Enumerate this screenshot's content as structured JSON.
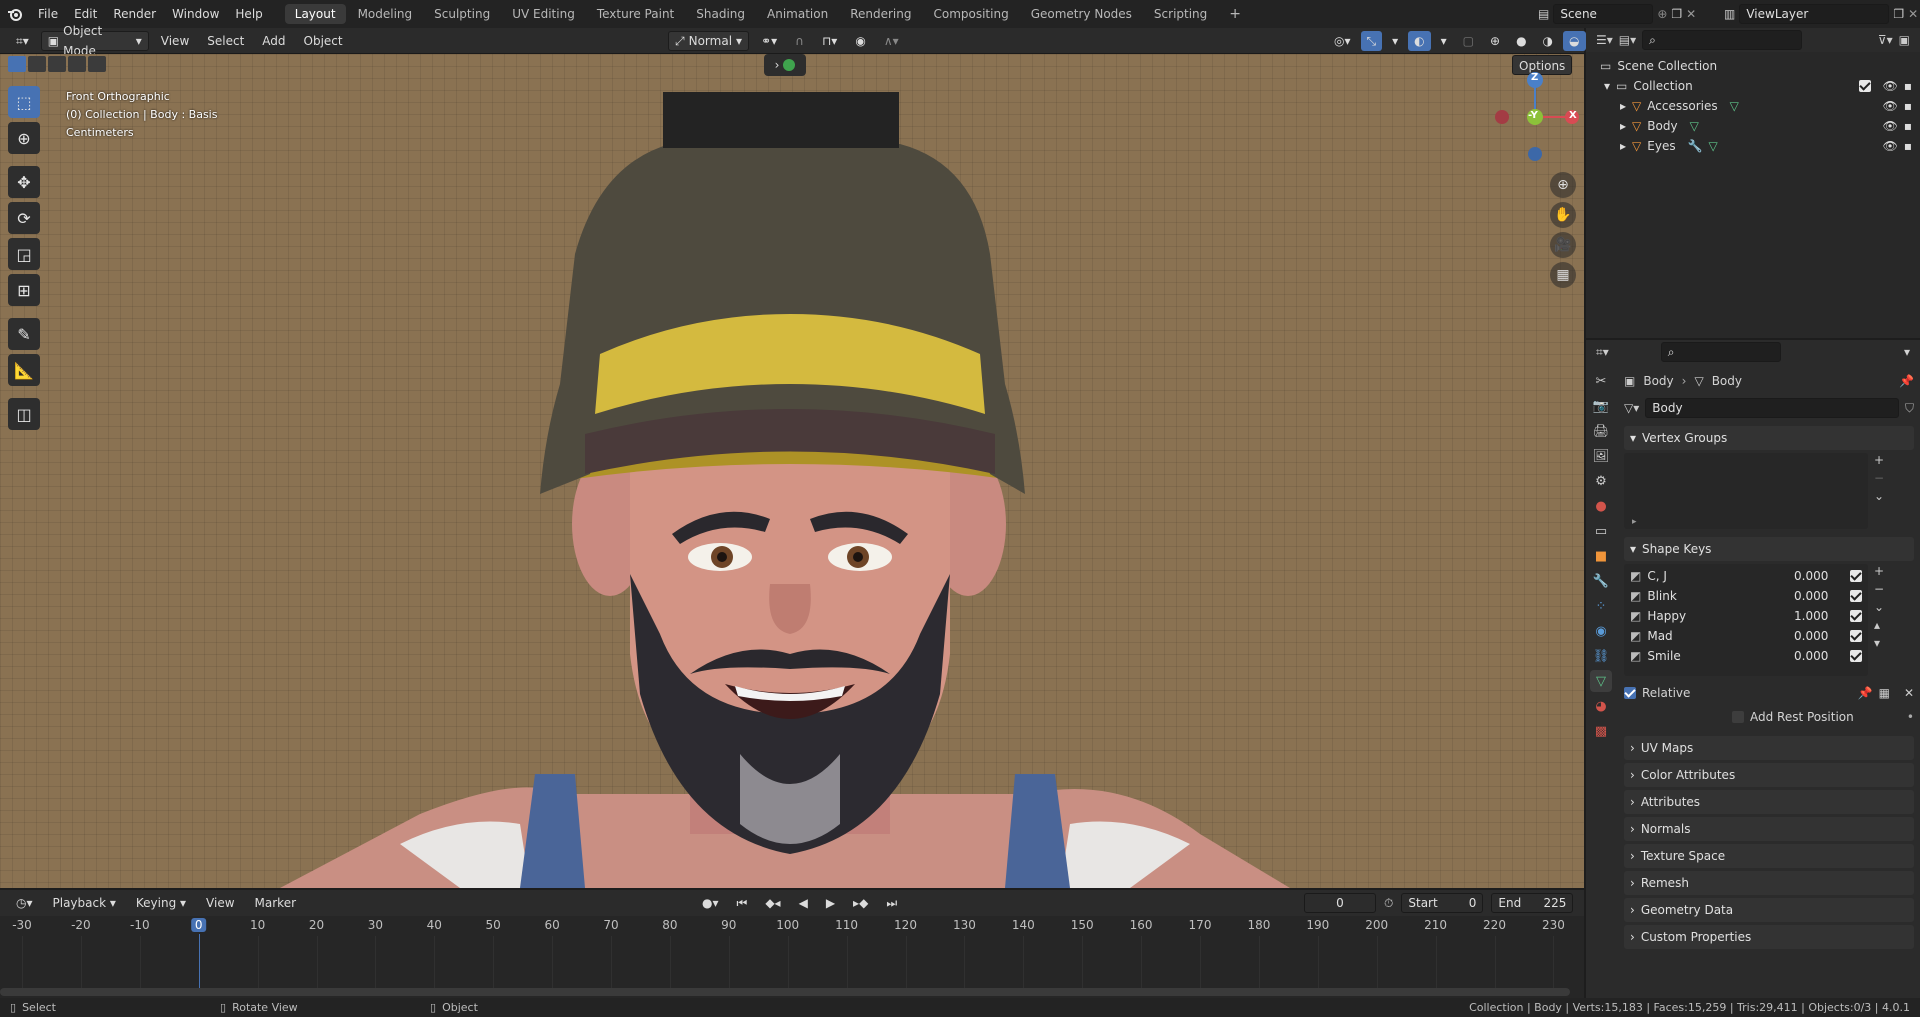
{
  "app": {
    "logo": "blender-logo"
  },
  "menu": [
    "File",
    "Edit",
    "Render",
    "Window",
    "Help"
  ],
  "workspaces": [
    "Layout",
    "Modeling",
    "Sculpting",
    "UV Editing",
    "Texture Paint",
    "Shading",
    "Animation",
    "Rendering",
    "Compositing",
    "Geometry Nodes",
    "Scripting"
  ],
  "active_workspace": "Layout",
  "scene": {
    "name": "Scene",
    "view_layer": "ViewLayer"
  },
  "viewport_header": {
    "mode": "Object Mode",
    "menus": [
      "View",
      "Select",
      "Add",
      "Object"
    ],
    "orientation": "Normal",
    "options": "Options"
  },
  "viewport": {
    "view_name": "Front Orthographic",
    "context": "(0) Collection | Body : Basis",
    "units": "Centimeters",
    "gizmo": {
      "z": "Z",
      "y": "-Y",
      "x": "X"
    },
    "colors": {
      "background": "#8a7252",
      "active_tool": "#4772b3"
    }
  },
  "outliner": {
    "root": "Scene Collection",
    "collection": "Collection",
    "items": [
      "Accessories",
      "Body",
      "Eyes"
    ]
  },
  "properties": {
    "breadcrumb": {
      "object": "Body",
      "data": "Body"
    },
    "mesh_name": "Body",
    "vertex_groups_label": "Vertex Groups",
    "shape_keys_label": "Shape Keys",
    "shape_keys": [
      {
        "name": "C, J",
        "value": "0.000"
      },
      {
        "name": "Blink",
        "value": "0.000"
      },
      {
        "name": "Happy",
        "value": "1.000"
      },
      {
        "name": "Mad",
        "value": "0.000"
      },
      {
        "name": "Smile",
        "value": "0.000"
      }
    ],
    "relative_label": "Relative",
    "add_rest_position": "Add Rest Position",
    "panels": [
      "UV Maps",
      "Color Attributes",
      "Attributes",
      "Normals",
      "Texture Space",
      "Remesh",
      "Geometry Data",
      "Custom Properties"
    ]
  },
  "timeline": {
    "menus": [
      "Playback",
      "Keying",
      "View",
      "Marker"
    ],
    "current_frame": "0",
    "start_label": "Start",
    "start": "0",
    "end_label": "End",
    "end": "225",
    "ticks": [
      "-30",
      "-20",
      "-10",
      "0",
      "10",
      "20",
      "30",
      "40",
      "50",
      "60",
      "70",
      "80",
      "90",
      "100",
      "110",
      "120",
      "130",
      "140",
      "150",
      "160",
      "170",
      "180",
      "190",
      "200",
      "210",
      "220",
      "230"
    ]
  },
  "statusbar": {
    "left": [
      "Select",
      "Rotate View",
      "Object"
    ],
    "right": "Collection | Body | Verts:15,183 | Faces:15,259 | Tris:29,411 | Objects:0/3 | 4.0.1"
  }
}
